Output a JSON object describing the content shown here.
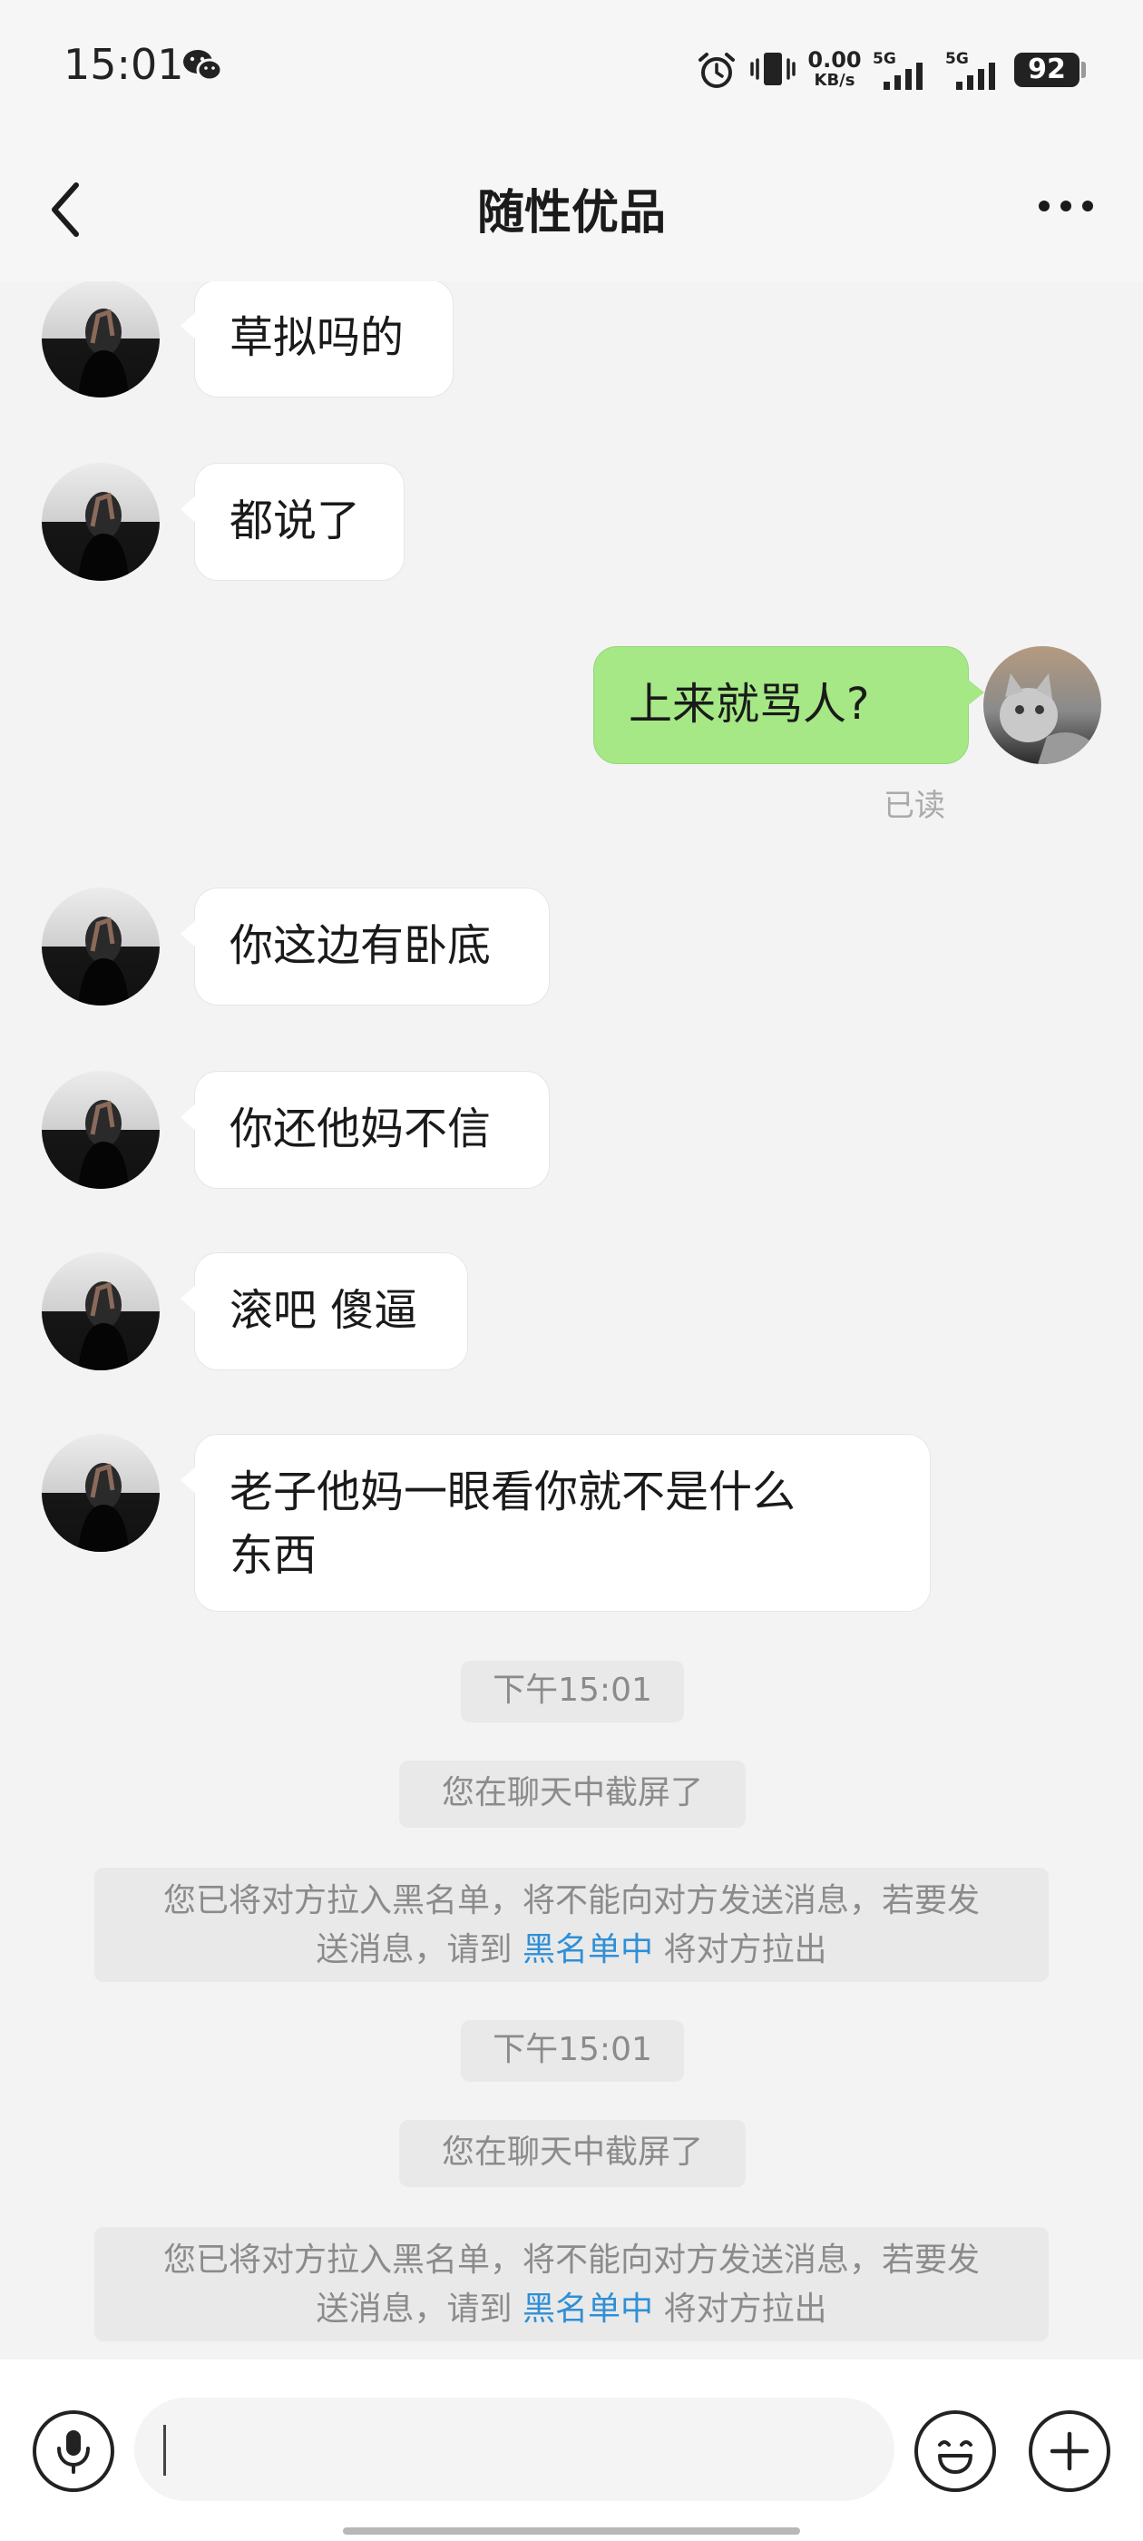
{
  "status_bar": {
    "time": "15:01",
    "net_speed_value": "0.00",
    "net_speed_unit": "KB/s",
    "sim1_label": "5G",
    "sim2_label": "5G",
    "battery": "92",
    "icons": [
      "wechat-icon",
      "alarm-icon",
      "vibrate-icon",
      "signal-icon",
      "battery-icon"
    ]
  },
  "header": {
    "title": "随性优品",
    "icons": [
      "back-icon",
      "more-icon"
    ]
  },
  "messages": [
    {
      "sender": "other",
      "text": "草拟吗的"
    },
    {
      "sender": "other",
      "text": "都说了"
    },
    {
      "sender": "me",
      "text": "上来就骂人?",
      "status": "已读"
    },
    {
      "sender": "other",
      "text": "你这边有卧底"
    },
    {
      "sender": "other",
      "text": "你还他妈不信"
    },
    {
      "sender": "other",
      "text": "滚吧 傻逼"
    },
    {
      "sender": "other",
      "text": "老子他妈一眼看你就不是什么\n东西"
    }
  ],
  "system_notices": [
    {
      "time": "下午15:01",
      "screenshot_notice": "您在聊天中截屏了",
      "blacklist_line1": "您已将对方拉入黑名单，将不能向对方发送消息，若要发",
      "blacklist_line2_prefix": "送消息，请到",
      "blacklist_link": "黑名单中",
      "blacklist_line2_suffix": "将对方拉出"
    },
    {
      "time": "下午15:01",
      "screenshot_notice": "您在聊天中截屏了",
      "blacklist_line1": "您已将对方拉入黑名单，将不能向对方发送消息，若要发",
      "blacklist_line2_prefix": "送消息，请到",
      "blacklist_link": "黑名单中",
      "blacklist_line2_suffix": "将对方拉出"
    }
  ],
  "input_bar": {
    "value": "",
    "icons": [
      "microphone-icon",
      "emoji-icon",
      "plus-icon"
    ]
  },
  "colors": {
    "my_bubble": "#a5e885",
    "link": "#2f8fd6",
    "background": "#f3f3f3"
  }
}
